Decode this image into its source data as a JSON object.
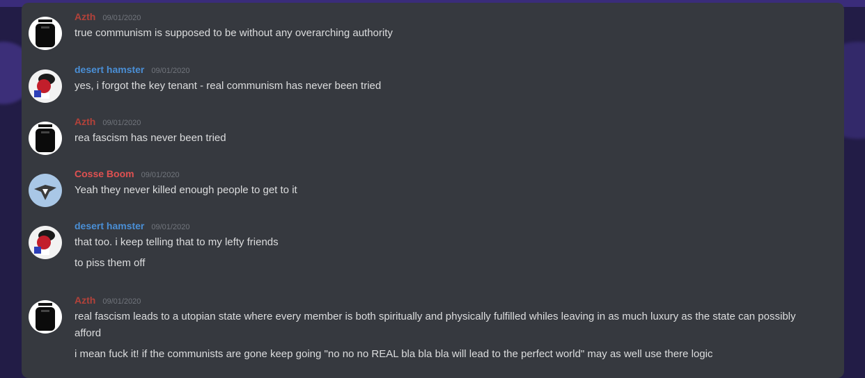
{
  "colors": {
    "accent_user_azth": "#b3423a",
    "accent_user_hamster": "#4a8fd6",
    "accent_user_cosse": "#e05151"
  },
  "messages": [
    {
      "author": "Azth",
      "author_color": "#b3423a",
      "avatar": "dark-robot-avatar-icon",
      "timestamp": "09/01/2020",
      "lines": [
        "true communism is supposed to be without any overarching authority"
      ]
    },
    {
      "author": "desert hamster",
      "author_color": "#4a8fd6",
      "avatar": "hamster-avatar-icon",
      "timestamp": "09/01/2020",
      "lines": [
        "yes, i forgot the key tenant - real communism has never been tried"
      ]
    },
    {
      "author": "Azth",
      "author_color": "#b3423a",
      "avatar": "dark-robot-avatar-icon",
      "timestamp": "09/01/2020",
      "lines": [
        "rea fascism has never been tried"
      ]
    },
    {
      "author": "Cosse Boom",
      "author_color": "#e05151",
      "avatar": "bird-avatar-icon",
      "timestamp": "09/01/2020",
      "lines": [
        "Yeah they never killed enough people to get to it"
      ]
    },
    {
      "author": "desert hamster",
      "author_color": "#4a8fd6",
      "avatar": "hamster-avatar-icon",
      "timestamp": "09/01/2020",
      "lines": [
        "that too. i keep telling that to my lefty friends",
        "to piss them off"
      ]
    },
    {
      "author": "Azth",
      "author_color": "#b3423a",
      "avatar": "dark-robot-avatar-icon",
      "timestamp": "09/01/2020",
      "lines": [
        "real fascism leads to a utopian state where every member is both spiritually and physically fulfilled whiles leaving in as much luxury as the state can possibly afford",
        "i mean fuck it! if the communists are gone keep going \"no no no REAL bla bla bla will lead to the perfect world\" may as well use there logic"
      ]
    }
  ]
}
